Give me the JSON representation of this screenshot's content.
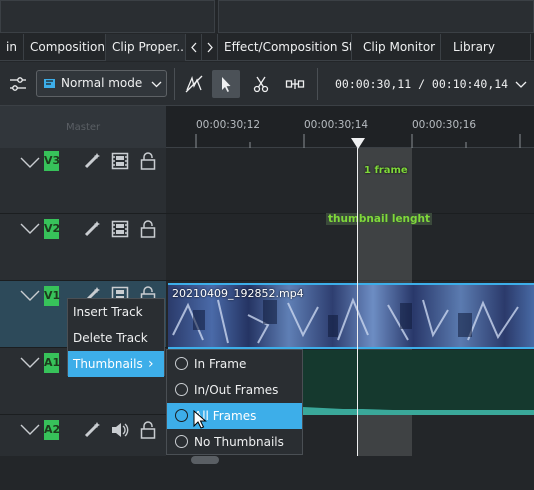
{
  "tabs": [
    {
      "label": "in"
    },
    {
      "label": "Compositions"
    },
    {
      "label": "Clip Proper..."
    },
    {
      "label": "Effect/Composition Stack"
    },
    {
      "label": "Clip Monitor"
    },
    {
      "label": "Library"
    }
  ],
  "toolbar": {
    "mode_label": "Normal mode",
    "timecode": "00:00:30,11 / 00:10:40,14",
    "icons": [
      "settings-sliders-icon",
      "razor-disabled-icon",
      "select-arrow-icon",
      "cut-scissors-icon",
      "spacer-icon",
      "chevron-down-icon"
    ]
  },
  "ruler": {
    "master_label": "Master",
    "labels": [
      "00:00:30;12",
      "00:00:30;14",
      "00:00:30;16"
    ]
  },
  "tracks": [
    {
      "tag": "V3"
    },
    {
      "tag": "V2"
    },
    {
      "tag": "V1"
    },
    {
      "tag": "A1"
    },
    {
      "tag": "A2"
    }
  ],
  "annotations": {
    "frame_label": "1 frame",
    "thumb_label": "thumbnail lenght"
  },
  "clip": {
    "name": "20210409_192852.mp4"
  },
  "context_menu": {
    "items": [
      "Insert Track",
      "Delete Track",
      "Thumbnails"
    ],
    "arrow": "›"
  },
  "submenu": {
    "items": [
      "In Frame",
      "In/Out Frames",
      "All Frames",
      "No Thumbnails"
    ],
    "highlighted": "All Frames"
  },
  "colors": {
    "accent": "#3daee9",
    "track_tag": "#37c25a",
    "annotation_text": "#7fd93a"
  }
}
